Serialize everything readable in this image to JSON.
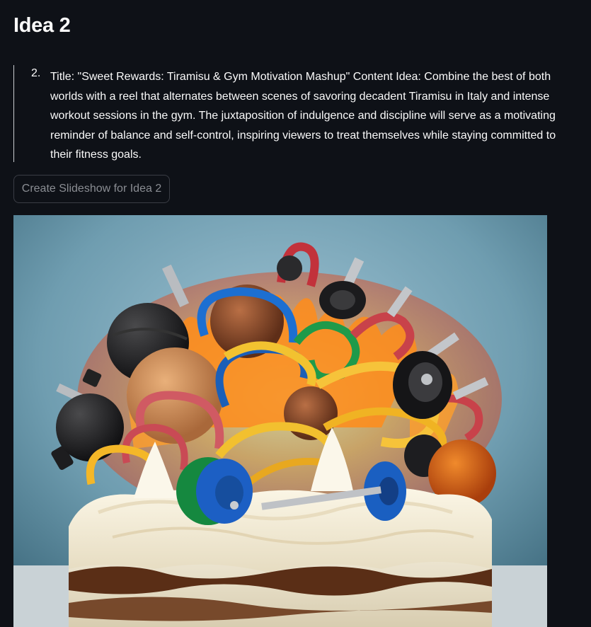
{
  "header": {
    "title": "Idea 2"
  },
  "idea": {
    "number": "2.",
    "text": "Title: \"Sweet Rewards: Tiramisu & Gym Motivation Mashup\" Content Idea: Combine the best of both worlds with a reel that alternates between scenes of savoring decadent Tiramisu in Italy and intense workout sessions in the gym. The juxtaposition of indulgence and discipline will serve as a motivating reminder of balance and self-control, inspiring viewers to treat themselves while staying committed to their fitness goals."
  },
  "actions": {
    "create_slideshow_label": "Create Slideshow for Idea 2"
  },
  "colors": {
    "background": "#0e1117",
    "text": "#fafafa",
    "button_text": "#8a8d93",
    "button_border": "#3a3d45",
    "quote_border": "#c9ccd1"
  }
}
